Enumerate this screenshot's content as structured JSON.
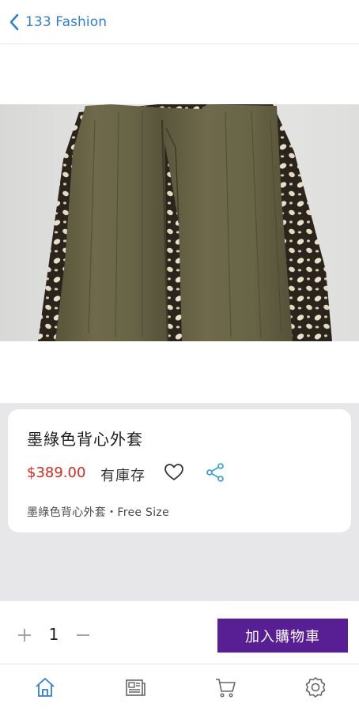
{
  "header": {
    "back_label": "133 Fashion",
    "back_icon": "chevron-left-icon"
  },
  "product": {
    "image": "olive vest with leopard-print lining",
    "title": "墨綠色背心外套",
    "price": "$389.00",
    "stock": "有庫存",
    "description": "墨綠色背心外套・Free Size",
    "favorite_icon": "heart-icon",
    "share_icon": "share-icon"
  },
  "cart": {
    "quantity": "1",
    "add_label": "加入購物車",
    "button_color": "#581f94"
  },
  "tabbar": {
    "items": [
      {
        "icon": "home-icon",
        "active": true
      },
      {
        "icon": "news-icon",
        "active": false
      },
      {
        "icon": "cart-icon",
        "active": false
      },
      {
        "icon": "settings-icon",
        "active": false
      }
    ]
  },
  "colors": {
    "accent": "#2f7fd3",
    "price": "#d8281f",
    "background_gray": "#e7e7e9"
  }
}
